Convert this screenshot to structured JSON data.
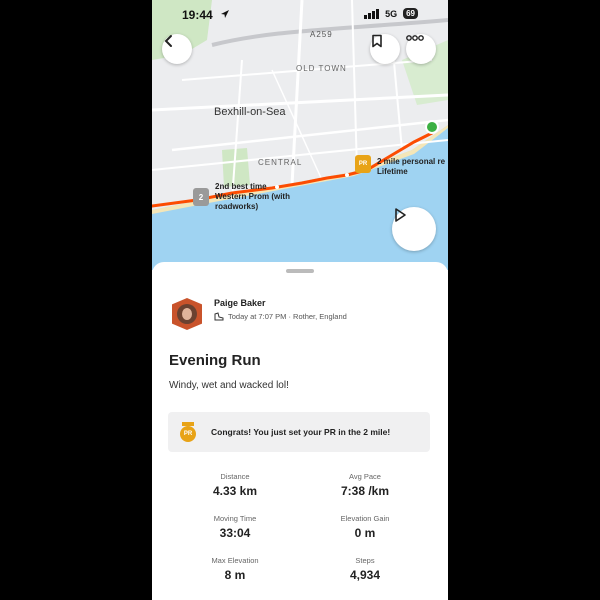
{
  "status_bar": {
    "time": "19:44",
    "network": "5G",
    "battery": "69"
  },
  "map": {
    "road_label": "A259",
    "area_old_town": "OLD TOWN",
    "town": "Bexhill-on-Sea",
    "area_central": "CENTRAL",
    "annotation_pr_line1": "2 mile personal re",
    "annotation_pr_line2": "Lifetime",
    "annotation_segment_line1": "2nd best time",
    "annotation_segment_line2": "Western Prom (with",
    "annotation_segment_line3": "roadworks)",
    "segment_rank": "2",
    "pr_badge": "PR"
  },
  "athlete": {
    "name": "Paige Baker",
    "meta": "Today at 7:07 PM · Rother, England"
  },
  "activity": {
    "title": "Evening Run",
    "description": "Windy, wet and wacked lol!",
    "pr_badge": "PR",
    "pr_message": "Congrats! You just set your PR in the 2 mile!"
  },
  "stats": [
    {
      "label": "Distance",
      "value": "4.33 km"
    },
    {
      "label": "Avg Pace",
      "value": "7:38 /km"
    },
    {
      "label": "Moving Time",
      "value": "33:04"
    },
    {
      "label": "Elevation Gain",
      "value": "0 m"
    },
    {
      "label": "Max Elevation",
      "value": "8 m"
    },
    {
      "label": "Steps",
      "value": "4,934"
    }
  ],
  "colors": {
    "route": "#fc4c02",
    "sea": "#9fd3f2",
    "park": "#cfe7c4",
    "pr_gold": "#e8a317",
    "avatar_border": "#c9532b"
  },
  "icons": [
    "back-arrow-icon",
    "bookmark-icon",
    "more-icon",
    "play-icon",
    "shoe-icon",
    "pr-medal-icon",
    "rank-medal-icon",
    "location-arrow-icon"
  ]
}
